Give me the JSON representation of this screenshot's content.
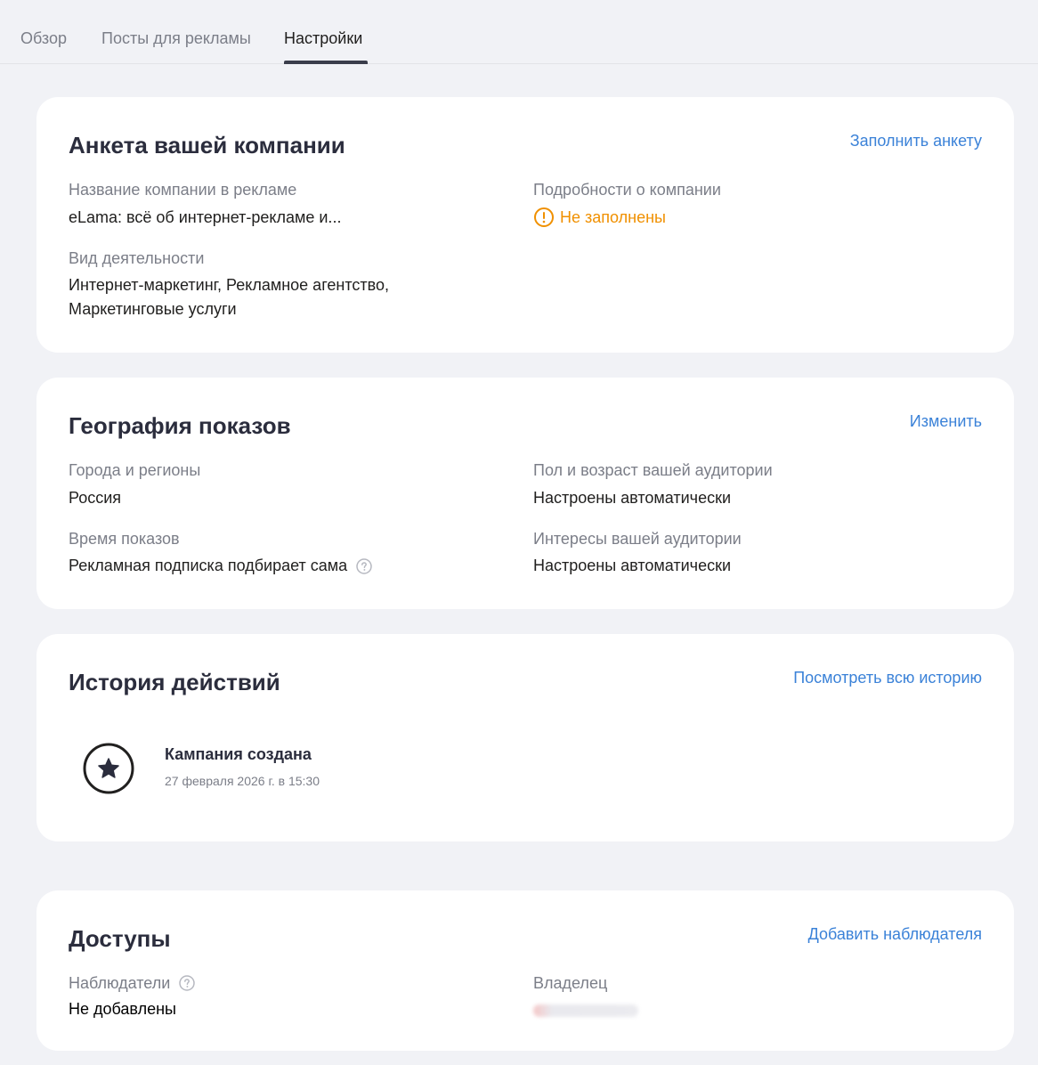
{
  "tabs": [
    {
      "label": "Обзор"
    },
    {
      "label": "Посты для рекламы"
    },
    {
      "label": "Настройки"
    }
  ],
  "company_card": {
    "title": "Анкета вашей компании",
    "action": "Заполнить анкету",
    "name_label": "Название компании в рекламе",
    "name_value": "eLama: всё об интернет-рекламе и...",
    "details_label": "Подробности о компании",
    "details_value": "Не заполнены",
    "activity_label": "Вид деятельности",
    "activity_value_line1": "Интернет-маркетинг, Рекламное агентство,",
    "activity_value_line2": "Маркетинговые услуги"
  },
  "geo_card": {
    "title": "География показов",
    "action": "Изменить",
    "regions_label": "Города и регионы",
    "regions_value": "Россия",
    "audience_label": "Пол и возраст вашей аудитории",
    "audience_value": "Настроены автоматически",
    "time_label": "Время показов",
    "time_value": "Рекламная подписка подбирает сама",
    "interests_label": "Интересы вашей аудитории",
    "interests_value": "Настроены автоматически"
  },
  "history_card": {
    "title": "История действий",
    "action": "Посмотреть всю историю",
    "event_title": "Кампания создана",
    "event_date": "27 февраля 2026 г. в 15:30"
  },
  "access_card": {
    "title": "Доступы",
    "action": "Добавить наблюдателя",
    "observers_label": "Наблюдатели",
    "observers_value": "Не добавлены",
    "owner_label": "Владелец"
  },
  "colors": {
    "accent_link": "#3b82d8",
    "warning": "#f09000",
    "background": "#f1f2f6"
  },
  "icons": {
    "warning": "exclamation-circle-icon",
    "help": "question-circle-icon",
    "history_event": "star-circle-icon"
  }
}
